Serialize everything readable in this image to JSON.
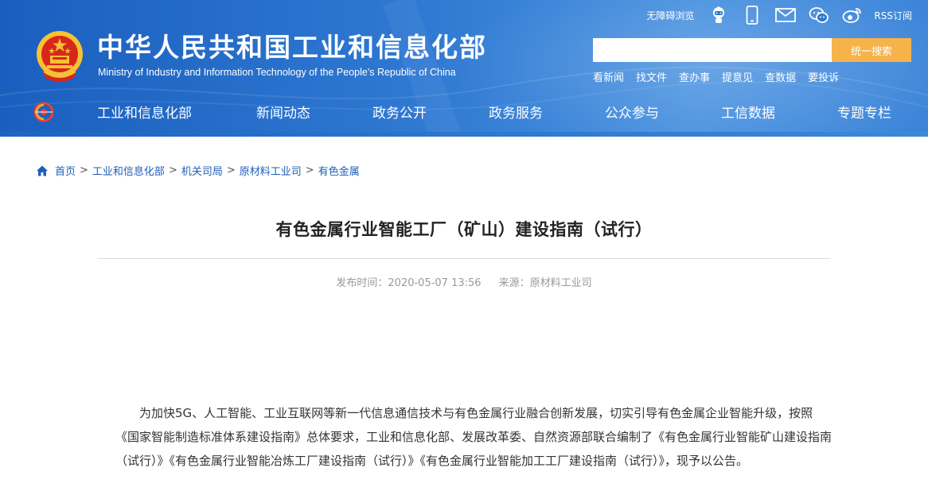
{
  "header": {
    "site_title": "中华人民共和国工业和信息化部",
    "site_subtitle": "Ministry of Industry and Information Technology of the People's Republic of China",
    "tools": {
      "accessibility": "无障碍浏览",
      "rss": "RSS订阅"
    },
    "search": {
      "placeholder": "",
      "button_label": "统一搜索"
    },
    "quick_links": [
      "看新闻",
      "找文件",
      "查办事",
      "提意见",
      "查数据",
      "要投诉"
    ],
    "nav": [
      "工业和信息化部",
      "新闻动态",
      "政务公开",
      "政务服务",
      "公众参与",
      "工信数据",
      "专题专栏"
    ]
  },
  "breadcrumb": [
    "首页",
    "工业和信息化部",
    "机关司局",
    "原材料工业司",
    "有色金属"
  ],
  "article": {
    "title": "有色金属行业智能工厂（矿山）建设指南（试行）",
    "published_label": "发布时间：",
    "published_value": "2020-05-07 13:56",
    "source_label": "来源：",
    "source_value": "原材料工业司",
    "paragraph": "为加快5G、人工智能、工业互联网等新一代信息通信技术与有色金属行业融合创新发展，切实引导有色金属企业智能升级，按照《国家智能制造标准体系建设指南》总体要求，工业和信息化部、发展改革委、自然资源部联合编制了《有色金属行业智能矿山建设指南（试行）》《有色金属行业智能冶炼工厂建设指南（试行）》《有色金属行业智能加工工厂建设指南（试行）》，现予以公告。"
  },
  "colors": {
    "header_blue": "#2f79d2",
    "search_button": "#f6b34a",
    "link_blue": "#1f5eb7"
  },
  "icons": [
    "national-emblem-icon",
    "robot-assistant-icon",
    "mobile-phone-icon",
    "mail-icon",
    "wechat-icon",
    "weibo-icon",
    "ministry-logo-icon",
    "home-icon"
  ]
}
